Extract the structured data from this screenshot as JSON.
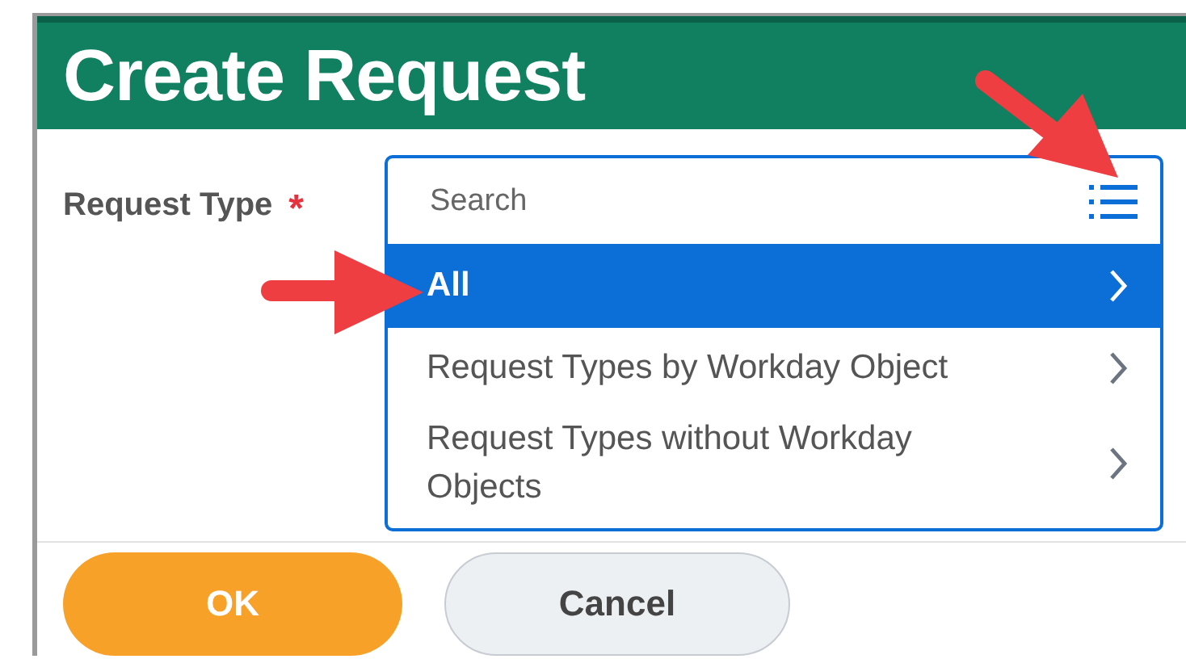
{
  "dialog": {
    "title": "Create Request"
  },
  "field": {
    "label": "Request Type",
    "required_mark": "*",
    "placeholder": "Search"
  },
  "options": [
    {
      "label": "All",
      "selected": true
    },
    {
      "label": "Request Types by Workday Object",
      "selected": false
    },
    {
      "label": "Request Types without Workday Objects",
      "selected": false
    }
  ],
  "buttons": [
    {
      "label": "OK",
      "kind": "primary"
    },
    {
      "label": "Cancel",
      "kind": "secondary"
    }
  ]
}
